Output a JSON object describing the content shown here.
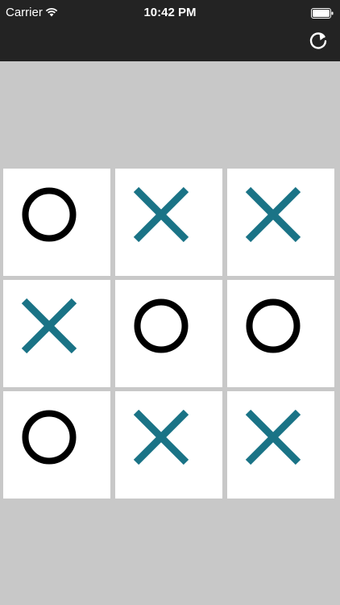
{
  "status_bar": {
    "carrier": "Carrier",
    "time": "10:42 PM",
    "wifi_icon": "wifi-icon",
    "battery_icon": "battery-icon"
  },
  "toolbar": {
    "refresh_icon": "refresh-icon"
  },
  "colors": {
    "background": "#c8c8c8",
    "topbar": "#232323",
    "x_mark": "#1a7386",
    "o_mark": "#000000",
    "cell": "#ffffff"
  },
  "board": {
    "rows": [
      [
        "O",
        "X",
        "X"
      ],
      [
        "X",
        "O",
        "O"
      ],
      [
        "O",
        "X",
        "X"
      ]
    ]
  }
}
